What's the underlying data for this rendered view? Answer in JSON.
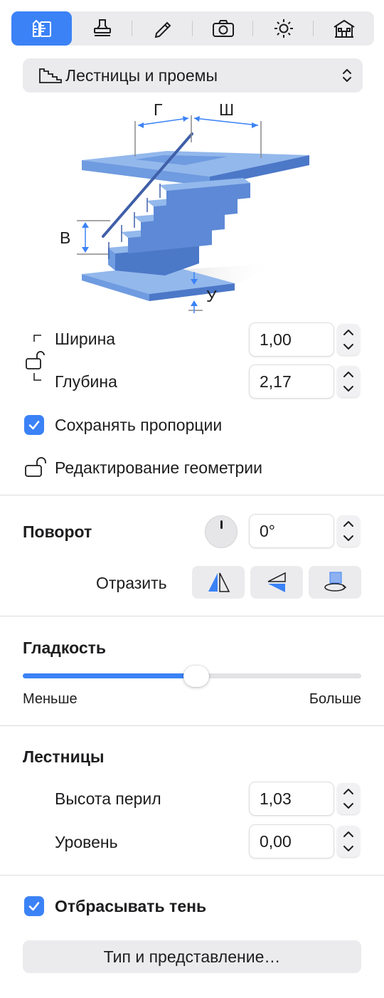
{
  "tabs": [
    {
      "name": "dimensions",
      "icon": "ruler-tools-icon",
      "active": true
    },
    {
      "name": "style",
      "icon": "stamp-icon",
      "active": false
    },
    {
      "name": "edit",
      "icon": "pencil-icon",
      "active": false
    },
    {
      "name": "camera",
      "icon": "camera-icon",
      "active": false
    },
    {
      "name": "light",
      "icon": "sun-icon",
      "active": false
    },
    {
      "name": "building",
      "icon": "house-icon",
      "active": false
    }
  ],
  "category": {
    "label": "Лестницы и проемы",
    "icon": "stairs-icon"
  },
  "illustration": {
    "label_g": "Г",
    "label_sh": "Ш",
    "label_v": "В",
    "label_u": "У"
  },
  "size": {
    "width_label": "Ширина",
    "width_value": "1,00",
    "depth_label": "Глубина",
    "depth_value": "2,17",
    "keep_proportions_label": "Сохранять пропорции",
    "keep_proportions_checked": true,
    "edit_geometry_label": "Редактирование геометрии"
  },
  "rotation": {
    "title": "Поворот",
    "value": "0°",
    "mirror_label": "Отразить"
  },
  "smoothness": {
    "title": "Гладкость",
    "min_label": "Меньше",
    "max_label": "Больше",
    "level": 0.5
  },
  "stairs": {
    "title": "Лестницы",
    "railing_height_label": "Высота перил",
    "railing_height_value": "1,03",
    "level_label": "Уровень",
    "level_value": "0,00"
  },
  "shadow": {
    "label": "Отбрасывать тень",
    "checked": true
  },
  "type_button_label": "Тип и представление…",
  "colors": {
    "accent": "#3b82f6",
    "stair_light": "#93b8ec",
    "stair_mid": "#6f9be0",
    "stair_dark": "#4c78c8"
  }
}
